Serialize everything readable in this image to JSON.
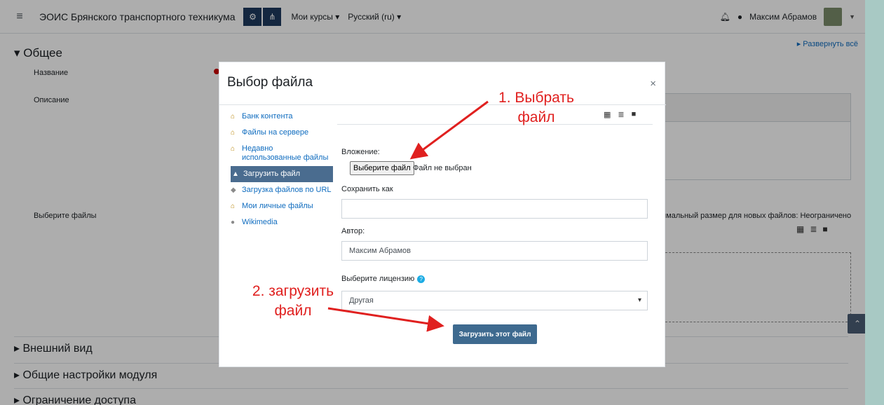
{
  "navbar": {
    "menu_icon": "hamburger-icon",
    "site_name": "ЭОИС Брянского транспортного техникума",
    "my_courses": "Мои курсы ▾",
    "language": "Русский (ru) ▾",
    "user_name": "Максим Абрамов"
  },
  "page": {
    "expand_all": "▸ Развернуть всё",
    "general_section": "▾ Общее",
    "name_label": "Название",
    "description_label": "Описание",
    "select_files_label": "Выберите файлы",
    "max_size_text": "имальный размер для новых файлов: Неограничено",
    "sections": [
      {
        "label": "▸ Внешний вид"
      },
      {
        "label": "▸ Общие настройки модуля"
      },
      {
        "label": "▸ Ограничение доступа"
      }
    ]
  },
  "modal": {
    "title": "Выбор файла",
    "close": "×",
    "repositories": [
      {
        "label": "Банк контента",
        "icon": "moodle-hat-icon"
      },
      {
        "label": "Файлы на сервере",
        "icon": "moodle-hat-icon"
      },
      {
        "label": "Недавно использованные файлы",
        "icon": "moodle-hat-icon"
      },
      {
        "label": "Загрузить файл",
        "icon": "upload-icon"
      },
      {
        "label": "Загрузка файлов по URL",
        "icon": "url-icon"
      },
      {
        "label": "Мои личные файлы",
        "icon": "moodle-hat-icon"
      },
      {
        "label": "Wikimedia",
        "icon": "wikimedia-icon"
      }
    ],
    "attachment_label": "Вложение:",
    "choose_file_button": "Выберите файл",
    "no_file_text": "Файл не выбран",
    "save_as_label": "Сохранить как",
    "save_as_value": "",
    "author_label": "Автор:",
    "author_value": "Максим Абрамов",
    "license_label": "Выберите лицензию",
    "license_value": "Другая",
    "upload_button": "Загрузить этот файл"
  },
  "annotations": {
    "step1_line1": "1. Выбрать",
    "step1_line2": "файл",
    "step2_line1": "2. загрузить",
    "step2_line2": "файл",
    "color": "#e0201f"
  }
}
